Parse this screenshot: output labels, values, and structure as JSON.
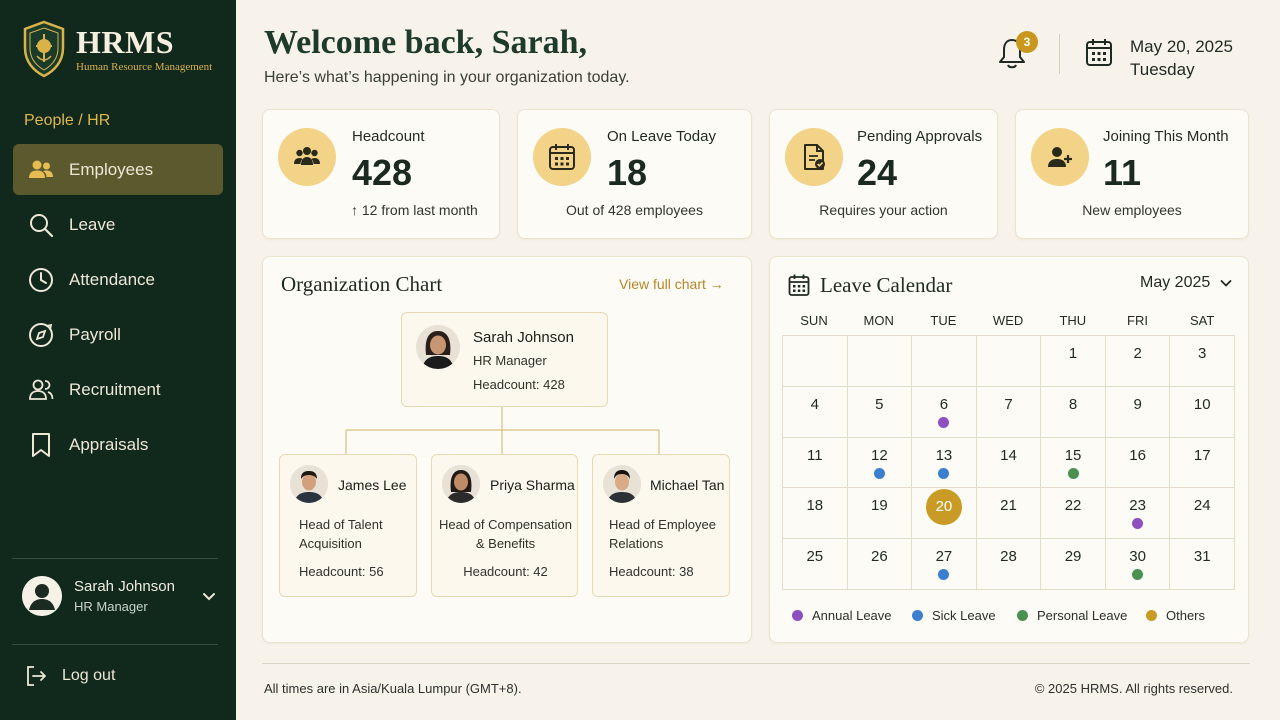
{
  "brand": {
    "title": "HRMS",
    "subtitle": "Human Resource Management"
  },
  "sidebar": {
    "section": "People / HR",
    "items": [
      {
        "label": "Employees",
        "icon": "users-icon"
      },
      {
        "label": "Leave",
        "icon": "search-icon"
      },
      {
        "label": "Attendance",
        "icon": "clock-icon"
      },
      {
        "label": "Payroll",
        "icon": "compass-icon"
      },
      {
        "label": "Recruitment",
        "icon": "people-icon"
      },
      {
        "label": "Appraisals",
        "icon": "bookmark-icon"
      }
    ],
    "active": "Employees",
    "user": {
      "name": "Sarah Johnson",
      "role": "HR Manager"
    },
    "logout": "Log out"
  },
  "header": {
    "welcome": "Welcome back, Sarah,",
    "subtitle": "Here’s what’s happening in your organization today.",
    "notifications": "3",
    "date": "May 20, 2025",
    "weekday": "Tuesday"
  },
  "stats": [
    {
      "label": "Headcount",
      "value": "428",
      "foot": "↑ 12 from last month",
      "icon": "users-icon"
    },
    {
      "label": "On Leave Today",
      "value": "18",
      "foot": "Out of 428 employees",
      "icon": "calendar-icon"
    },
    {
      "label": "Pending Approvals",
      "value": "24",
      "foot": "Requires your action",
      "icon": "document-check-icon"
    },
    {
      "label": "Joining This Month",
      "value": "11",
      "foot": "New employees",
      "icon": "user-plus-icon"
    }
  ],
  "org": {
    "title": "Organization Chart",
    "view_link": "View full chart →",
    "root": {
      "name": "Sarah Johnson",
      "role": "HR Manager",
      "headcount": "Headcount: 428"
    },
    "children": [
      {
        "name": "James Lee",
        "role1": "Head of Talent",
        "role2": "Acquisition",
        "headcount": "Headcount: 56"
      },
      {
        "name": "Priya Sharma",
        "role1": "Head of Compensation",
        "role2": "& Benefits",
        "headcount": "Headcount: 42"
      },
      {
        "name": "Michael Tan",
        "role1": "Head of Employee",
        "role2": "Relations",
        "headcount": "Headcount: 38"
      }
    ]
  },
  "calendar": {
    "title": "Leave Calendar",
    "month": "May 2025",
    "weekdays": [
      "SUN",
      "MON",
      "TUE",
      "WED",
      "THU",
      "FRI",
      "SAT"
    ],
    "first_weekday": 4,
    "days_in_month": 31,
    "today": 20,
    "markers": {
      "6": "annual",
      "12": "sick",
      "13": "sick",
      "15": "personal",
      "23": "annual",
      "27": "sick",
      "30": "personal"
    },
    "legend": [
      {
        "key": "annual",
        "label": "Annual Leave",
        "color": "#8e4fc0"
      },
      {
        "key": "sick",
        "label": "Sick Leave",
        "color": "#3a7fd0"
      },
      {
        "key": "personal",
        "label": "Personal Leave",
        "color": "#4a9050"
      },
      {
        "key": "others",
        "label": "Others",
        "color": "#c99b24"
      }
    ]
  },
  "footer": {
    "timezone": "All times are in Asia/Kuala Lumpur (GMT+8).",
    "copyright": "© 2025 HRMS. All rights reserved."
  }
}
